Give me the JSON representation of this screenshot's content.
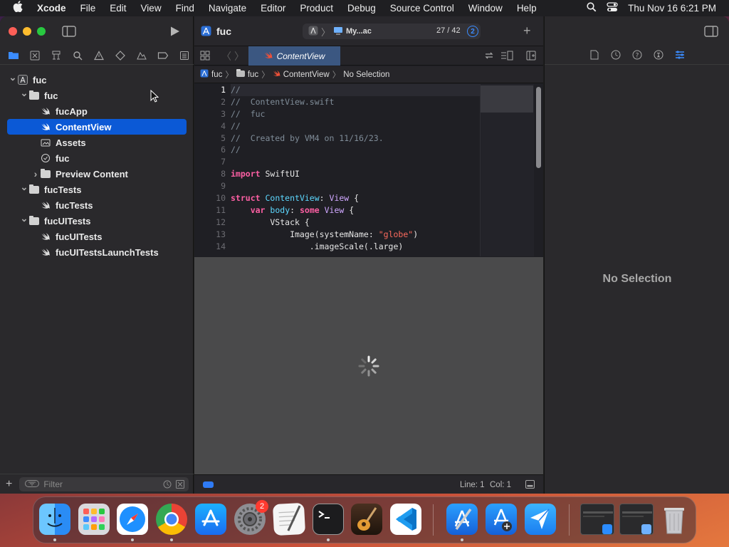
{
  "menubar": {
    "apple": "",
    "items": [
      "Xcode",
      "File",
      "Edit",
      "View",
      "Find",
      "Navigate",
      "Editor",
      "Product",
      "Debug",
      "Source Control",
      "Window",
      "Help"
    ],
    "clock": "Thu Nov 16  6:21 PM"
  },
  "toolbar": {
    "project_title": "fuc",
    "scheme": "My...ac",
    "counter": "27 / 42",
    "badge": "2"
  },
  "navigator": {
    "tree": [
      {
        "label": "fuc",
        "depth": 0,
        "disclosure": "open",
        "icon": "project-icon"
      },
      {
        "label": "fuc",
        "depth": 1,
        "disclosure": "open",
        "icon": "folder-icon"
      },
      {
        "label": "fucApp",
        "depth": 2,
        "disclosure": "none",
        "icon": "swift-file-icon"
      },
      {
        "label": "ContentView",
        "depth": 2,
        "disclosure": "none",
        "icon": "swift-file-icon",
        "selected": true
      },
      {
        "label": "Assets",
        "depth": 2,
        "disclosure": "none",
        "icon": "asset-catalog-icon"
      },
      {
        "label": "fuc",
        "depth": 2,
        "disclosure": "none",
        "icon": "entitlements-icon"
      },
      {
        "label": "Preview Content",
        "depth": 2,
        "disclosure": "closed",
        "icon": "folder-icon"
      },
      {
        "label": "fucTests",
        "depth": 1,
        "disclosure": "open",
        "icon": "folder-icon"
      },
      {
        "label": "fucTests",
        "depth": 2,
        "disclosure": "none",
        "icon": "swift-file-icon"
      },
      {
        "label": "fucUITests",
        "depth": 1,
        "disclosure": "open",
        "icon": "folder-icon"
      },
      {
        "label": "fucUITests",
        "depth": 2,
        "disclosure": "none",
        "icon": "swift-file-icon"
      },
      {
        "label": "fucUITestsLaunchTests",
        "depth": 2,
        "disclosure": "none",
        "icon": "swift-file-icon"
      }
    ],
    "filter_placeholder": "Filter"
  },
  "editor": {
    "tab_label": "ContentView",
    "jumpbar": [
      "fuc",
      "fuc",
      "ContentView",
      "No Selection"
    ],
    "line_numbers": [
      "1",
      "2",
      "3",
      "4",
      "5",
      "6",
      "7",
      "8",
      "9",
      "10",
      "11",
      "12",
      "13",
      "14"
    ],
    "code": [
      [
        {
          "t": "//",
          "c": "cmt"
        }
      ],
      [
        {
          "t": "//  ContentView.swift",
          "c": "cmt"
        }
      ],
      [
        {
          "t": "//  fuc",
          "c": "cmt"
        }
      ],
      [
        {
          "t": "//",
          "c": "cmt"
        }
      ],
      [
        {
          "t": "//  Created by VM4 on 11/16/23.",
          "c": "cmt"
        }
      ],
      [
        {
          "t": "//",
          "c": "cmt"
        }
      ],
      [
        {
          "t": "",
          "c": ""
        }
      ],
      [
        {
          "t": "import",
          "c": "kw"
        },
        {
          "t": " SwiftUI",
          "c": ""
        }
      ],
      [
        {
          "t": "",
          "c": ""
        }
      ],
      [
        {
          "t": "struct",
          "c": "kw"
        },
        {
          "t": " ",
          "c": ""
        },
        {
          "t": "ContentView",
          "c": "ty"
        },
        {
          "t": ": ",
          "c": ""
        },
        {
          "t": "View",
          "c": "ty2"
        },
        {
          "t": " {",
          "c": ""
        }
      ],
      [
        {
          "t": "    ",
          "c": ""
        },
        {
          "t": "var",
          "c": "kw"
        },
        {
          "t": " ",
          "c": ""
        },
        {
          "t": "body",
          "c": "ty"
        },
        {
          "t": ": ",
          "c": ""
        },
        {
          "t": "some",
          "c": "kw"
        },
        {
          "t": " ",
          "c": ""
        },
        {
          "t": "View",
          "c": "ty2"
        },
        {
          "t": " {",
          "c": ""
        }
      ],
      [
        {
          "t": "        VStack {",
          "c": ""
        }
      ],
      [
        {
          "t": "            Image(systemName: ",
          "c": ""
        },
        {
          "t": "\"globe\"",
          "c": "str"
        },
        {
          "t": ")",
          "c": ""
        }
      ],
      [
        {
          "t": "                .imageScale(.large)",
          "c": ""
        }
      ]
    ],
    "status_line": "Line: 1",
    "status_col": "Col: 1"
  },
  "inspector": {
    "empty_label": "No Selection"
  },
  "dock": {
    "apps": [
      "finder-icon",
      "launchpad-icon",
      "safari-icon",
      "chrome-icon",
      "app-store-icon",
      "system-settings-icon",
      "textedit-icon",
      "terminal-icon",
      "garageband-icon",
      "vscode-icon",
      "xcode-icon",
      "instruments-icon",
      "testflight-icon",
      "window-thumb-icon",
      "window-thumb-icon",
      "trash-icon"
    ],
    "settings_badge": "2"
  },
  "colors": {
    "selection": "#0b59d6",
    "tab_active": "#3b5781",
    "keyword": "#fc5fa3",
    "type": "#5dd8ff",
    "string": "#fc6a5d",
    "comment": "#7f8c98"
  }
}
